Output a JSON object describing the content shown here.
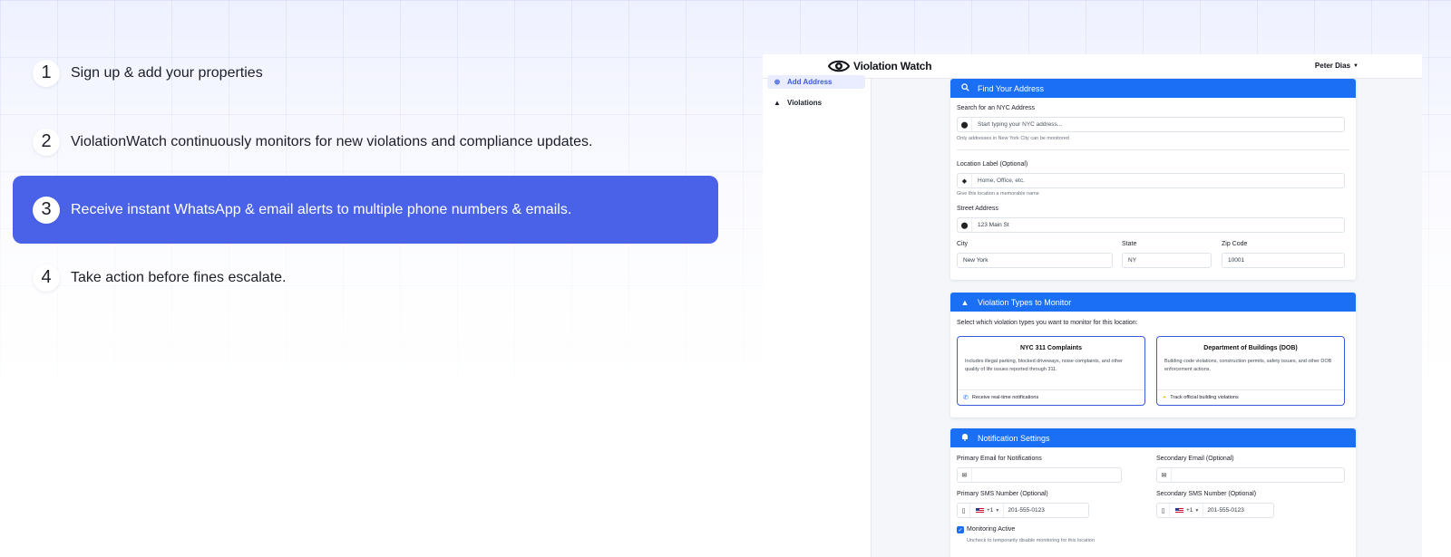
{
  "steps": [
    {
      "number": "1",
      "text": "Sign up & add your properties"
    },
    {
      "number": "2",
      "text": "ViolationWatch continuously monitors for new violations and compliance updates."
    },
    {
      "number": "3",
      "text": "Receive instant WhatsApp & email alerts to multiple phone numbers & emails."
    },
    {
      "number": "4",
      "text": "Take action before fines escalate."
    }
  ],
  "active_step": 3,
  "colors": {
    "accent": "#4a62e8",
    "header_blue": "#1a6ff5"
  },
  "app": {
    "brand": "Violation Watch",
    "user": "Peter Dias",
    "sidebar": [
      {
        "label": "Add Address",
        "icon": "plus-circle-icon",
        "active": true
      },
      {
        "label": "Violations",
        "icon": "warning-icon",
        "active": false
      }
    ],
    "find_address": {
      "title": "Find Your Address",
      "search_label": "Search for an NYC Address",
      "search_placeholder": "Start typing your NYC address...",
      "search_hint": "Only addresses in New York City can be monitored",
      "location_label": "Location Label (Optional)",
      "location_placeholder": "Home, Office, etc.",
      "location_hint": "Give this location a memorable name",
      "street_label": "Street Address",
      "street_value": "123 Main St",
      "city_label": "City",
      "city_value": "New York",
      "state_label": "State",
      "state_value": "NY",
      "zip_label": "Zip Code",
      "zip_value": "10001"
    },
    "violation_types": {
      "title": "Violation Types to Monitor",
      "intro": "Select which violation types you want to monitor for this location:",
      "options": [
        {
          "title": "NYC 311 Complaints",
          "description": "Includes illegal parking, blocked driveways, noise complaints, and other quality of life issues reported through 311.",
          "footer": "Receive real-time notifications",
          "footer_icon": "phone-icon"
        },
        {
          "title": "Department of Buildings (DOB)",
          "description": "Building code violations, construction permits, safety issues, and other DOB enforcement actions.",
          "footer": "Track official building violations",
          "footer_icon": "hard-hat-icon"
        }
      ]
    },
    "notifications": {
      "title": "Notification Settings",
      "primary_email_label": "Primary Email for Notifications",
      "secondary_email_label": "Secondary Email (Optional)",
      "primary_sms_label": "Primary SMS Number (Optional)",
      "secondary_sms_label": "Secondary SMS Number (Optional)",
      "country_code": "+1",
      "primary_sms_placeholder": "201-555-0123",
      "secondary_sms_placeholder": "201-555-0123",
      "monitoring_label": "Monitoring Active",
      "monitoring_hint": "Uncheck to temporarily disable monitoring for this location",
      "monitoring_checked": true
    }
  }
}
